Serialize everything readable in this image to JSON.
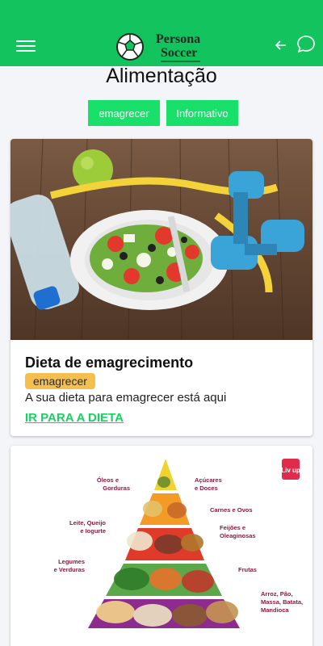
{
  "app": {
    "logo_line1": "Persona",
    "logo_line2": "Soccer"
  },
  "page": {
    "title": "Alimentação"
  },
  "filters": [
    {
      "label": "emagrecer"
    },
    {
      "label": "Informativo"
    }
  ],
  "cards": [
    {
      "title": "Dieta de emagrecimento",
      "tag": "emagrecer",
      "description": "A sua dieta para emagrecer está aqui",
      "link": "IR PARA A DIETA"
    }
  ],
  "pyramid": {
    "brand": "Liv up",
    "labels": {
      "oleos": "Óleos e",
      "oleos2": "Gorduras",
      "acucares": "Açúcares",
      "acucares2": "e Doces",
      "carnes": "Carnes e Ovos",
      "leite": "Leite, Queijo",
      "leite2": "e Iogurte",
      "feijoes": "Feijões e",
      "feijoes2": "Oleaginosas",
      "legumes": "Legumes",
      "legumes2": "e Verduras",
      "frutas": "Frutas",
      "arroz": "Arroz, Pão,",
      "arroz2": "Massa, Batata,",
      "arroz3": "Mandioca"
    }
  },
  "colors": {
    "primary": "#13c35d",
    "chip": "#19e06a",
    "tag": "#f5bf4f",
    "link": "#19d063"
  }
}
